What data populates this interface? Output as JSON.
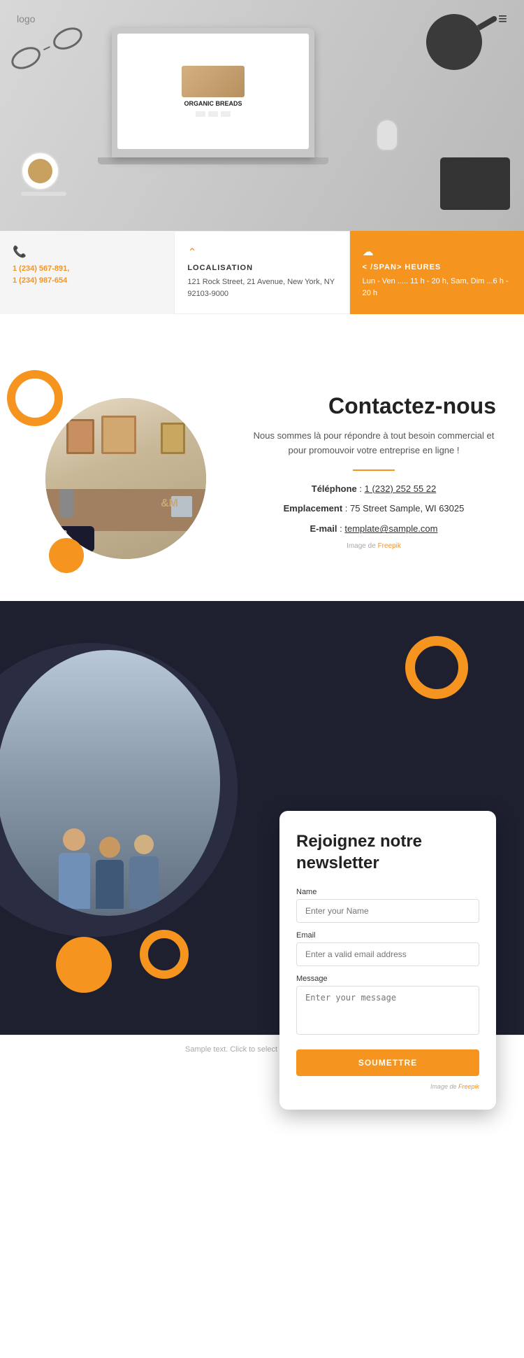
{
  "header": {
    "logo": "logo",
    "menu_icon": "≡"
  },
  "hero": {
    "laptop_screen_title": "ORGANIC BREADS"
  },
  "info_cards": [
    {
      "id": "phone",
      "icon": "📞",
      "title": "",
      "text": "1 (234) 567-891,\n1 (234) 987-654",
      "bg": "light"
    },
    {
      "id": "location",
      "icon": "^",
      "title": "LOCALISATION",
      "text": "121 Rock Street, 21 Avenue, New York, NY 92103-9000",
      "bg": "white"
    },
    {
      "id": "hours",
      "icon": "☁",
      "title": "< /SPAN> HEURES",
      "text": "Lun - Ven ..... 11 h - 20 h, Sam, Dim ...6 h - 20 h",
      "bg": "orange"
    }
  ],
  "contact": {
    "title": "Contactez-nous",
    "description": "Nous sommes là pour répondre à tout besoin commercial et pour promouvoir votre entreprise en ligne !",
    "phone_label": "Téléphone",
    "phone_value": "1 (232) 252 55 22",
    "location_label": "Emplacement",
    "location_value": "75 Street Sample, WI 63025",
    "email_label": "E-mail",
    "email_value": "template@sample.com",
    "image_credit": "Image de",
    "freepik_link": "Freepik"
  },
  "dark_section": {
    "newsletter": {
      "title": "Rejoignez notre newsletter",
      "name_label": "Name",
      "name_placeholder": "Enter your Name",
      "email_label": "Email",
      "email_placeholder": "Enter a valid email address",
      "message_label": "Message",
      "message_placeholder": "Enter your message",
      "submit_label": "SOUMETTRE",
      "image_credit": "Image de",
      "freepik_link": "Freepik"
    }
  },
  "footer": {
    "text": "Sample text. Click to select the Text Element."
  }
}
